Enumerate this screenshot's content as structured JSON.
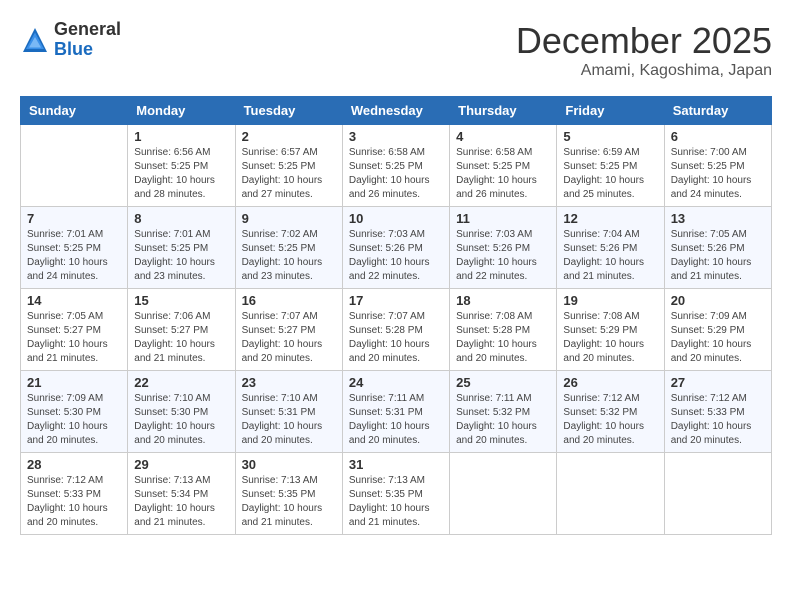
{
  "logo": {
    "general": "General",
    "blue": "Blue"
  },
  "header": {
    "month": "December 2025",
    "location": "Amami, Kagoshima, Japan"
  },
  "weekdays": [
    "Sunday",
    "Monday",
    "Tuesday",
    "Wednesday",
    "Thursday",
    "Friday",
    "Saturday"
  ],
  "weeks": [
    [
      {
        "day": "",
        "info": ""
      },
      {
        "day": "1",
        "info": "Sunrise: 6:56 AM\nSunset: 5:25 PM\nDaylight: 10 hours\nand 28 minutes."
      },
      {
        "day": "2",
        "info": "Sunrise: 6:57 AM\nSunset: 5:25 PM\nDaylight: 10 hours\nand 27 minutes."
      },
      {
        "day": "3",
        "info": "Sunrise: 6:58 AM\nSunset: 5:25 PM\nDaylight: 10 hours\nand 26 minutes."
      },
      {
        "day": "4",
        "info": "Sunrise: 6:58 AM\nSunset: 5:25 PM\nDaylight: 10 hours\nand 26 minutes."
      },
      {
        "day": "5",
        "info": "Sunrise: 6:59 AM\nSunset: 5:25 PM\nDaylight: 10 hours\nand 25 minutes."
      },
      {
        "day": "6",
        "info": "Sunrise: 7:00 AM\nSunset: 5:25 PM\nDaylight: 10 hours\nand 24 minutes."
      }
    ],
    [
      {
        "day": "7",
        "info": "Sunrise: 7:01 AM\nSunset: 5:25 PM\nDaylight: 10 hours\nand 24 minutes."
      },
      {
        "day": "8",
        "info": "Sunrise: 7:01 AM\nSunset: 5:25 PM\nDaylight: 10 hours\nand 23 minutes."
      },
      {
        "day": "9",
        "info": "Sunrise: 7:02 AM\nSunset: 5:25 PM\nDaylight: 10 hours\nand 23 minutes."
      },
      {
        "day": "10",
        "info": "Sunrise: 7:03 AM\nSunset: 5:26 PM\nDaylight: 10 hours\nand 22 minutes."
      },
      {
        "day": "11",
        "info": "Sunrise: 7:03 AM\nSunset: 5:26 PM\nDaylight: 10 hours\nand 22 minutes."
      },
      {
        "day": "12",
        "info": "Sunrise: 7:04 AM\nSunset: 5:26 PM\nDaylight: 10 hours\nand 21 minutes."
      },
      {
        "day": "13",
        "info": "Sunrise: 7:05 AM\nSunset: 5:26 PM\nDaylight: 10 hours\nand 21 minutes."
      }
    ],
    [
      {
        "day": "14",
        "info": "Sunrise: 7:05 AM\nSunset: 5:27 PM\nDaylight: 10 hours\nand 21 minutes."
      },
      {
        "day": "15",
        "info": "Sunrise: 7:06 AM\nSunset: 5:27 PM\nDaylight: 10 hours\nand 21 minutes."
      },
      {
        "day": "16",
        "info": "Sunrise: 7:07 AM\nSunset: 5:27 PM\nDaylight: 10 hours\nand 20 minutes."
      },
      {
        "day": "17",
        "info": "Sunrise: 7:07 AM\nSunset: 5:28 PM\nDaylight: 10 hours\nand 20 minutes."
      },
      {
        "day": "18",
        "info": "Sunrise: 7:08 AM\nSunset: 5:28 PM\nDaylight: 10 hours\nand 20 minutes."
      },
      {
        "day": "19",
        "info": "Sunrise: 7:08 AM\nSunset: 5:29 PM\nDaylight: 10 hours\nand 20 minutes."
      },
      {
        "day": "20",
        "info": "Sunrise: 7:09 AM\nSunset: 5:29 PM\nDaylight: 10 hours\nand 20 minutes."
      }
    ],
    [
      {
        "day": "21",
        "info": "Sunrise: 7:09 AM\nSunset: 5:30 PM\nDaylight: 10 hours\nand 20 minutes."
      },
      {
        "day": "22",
        "info": "Sunrise: 7:10 AM\nSunset: 5:30 PM\nDaylight: 10 hours\nand 20 minutes."
      },
      {
        "day": "23",
        "info": "Sunrise: 7:10 AM\nSunset: 5:31 PM\nDaylight: 10 hours\nand 20 minutes."
      },
      {
        "day": "24",
        "info": "Sunrise: 7:11 AM\nSunset: 5:31 PM\nDaylight: 10 hours\nand 20 minutes."
      },
      {
        "day": "25",
        "info": "Sunrise: 7:11 AM\nSunset: 5:32 PM\nDaylight: 10 hours\nand 20 minutes."
      },
      {
        "day": "26",
        "info": "Sunrise: 7:12 AM\nSunset: 5:32 PM\nDaylight: 10 hours\nand 20 minutes."
      },
      {
        "day": "27",
        "info": "Sunrise: 7:12 AM\nSunset: 5:33 PM\nDaylight: 10 hours\nand 20 minutes."
      }
    ],
    [
      {
        "day": "28",
        "info": "Sunrise: 7:12 AM\nSunset: 5:33 PM\nDaylight: 10 hours\nand 20 minutes."
      },
      {
        "day": "29",
        "info": "Sunrise: 7:13 AM\nSunset: 5:34 PM\nDaylight: 10 hours\nand 21 minutes."
      },
      {
        "day": "30",
        "info": "Sunrise: 7:13 AM\nSunset: 5:35 PM\nDaylight: 10 hours\nand 21 minutes."
      },
      {
        "day": "31",
        "info": "Sunrise: 7:13 AM\nSunset: 5:35 PM\nDaylight: 10 hours\nand 21 minutes."
      },
      {
        "day": "",
        "info": ""
      },
      {
        "day": "",
        "info": ""
      },
      {
        "day": "",
        "info": ""
      }
    ]
  ]
}
